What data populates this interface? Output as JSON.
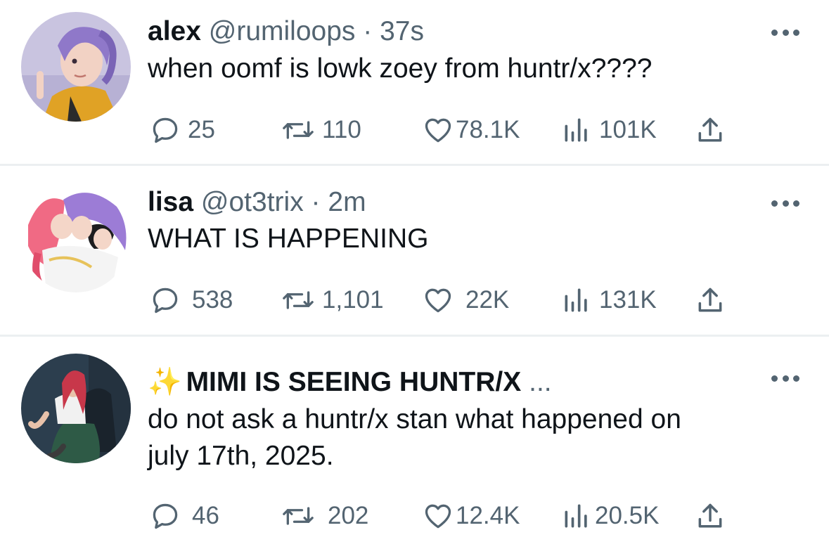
{
  "tweets": [
    {
      "name": "alex",
      "handle": "@rumiloops",
      "dot": "·",
      "time": "37s",
      "text_lines": [
        "when oomf is lowk zoey from huntr/x????"
      ],
      "replies": "25",
      "retweets": "110",
      "likes": "78.1K",
      "views": "101K",
      "avatar_colors": {
        "bg": "#c9c4e0",
        "hair": "#8f78c9",
        "skin": "#f2d2c4",
        "jacket": "#e0a225"
      }
    },
    {
      "name": "lisa",
      "handle": "@ot3trix",
      "dot": "·",
      "time": "2m",
      "text_lines": [
        "WHAT IS HAPPENING"
      ],
      "replies": "538",
      "retweets": "1,101",
      "likes": "22K",
      "views": "131K",
      "avatar_colors": {
        "bg": "#ffffff",
        "hair1": "#f06a84",
        "hair2": "#9c7cd6",
        "hair3": "#1d1d1f",
        "outfit": "#f4f4f4"
      }
    },
    {
      "name_prefix": "✨",
      "name": "MIMI IS SEEING HUNTR/X",
      "name_suffix": "...",
      "text_lines": [
        "do not ask a huntr/x stan what happened on",
        "july 17th, 2025."
      ],
      "replies": "46",
      "retweets": "202",
      "likes": "12.4K",
      "views": "20.5K",
      "avatar_colors": {
        "bg": "#2c3e4e",
        "hair": "#c8374a",
        "outfit": "#2e5a46",
        "skin": "#e8c2aa"
      }
    }
  ],
  "icons": {
    "reply": "reply-icon",
    "retweet": "retweet-icon",
    "like": "heart-icon",
    "views": "views-icon",
    "share": "share-icon",
    "more": "more-icon"
  },
  "colors": {
    "text": "#0f1419",
    "muted": "#536471",
    "divider": "#eceff1"
  }
}
